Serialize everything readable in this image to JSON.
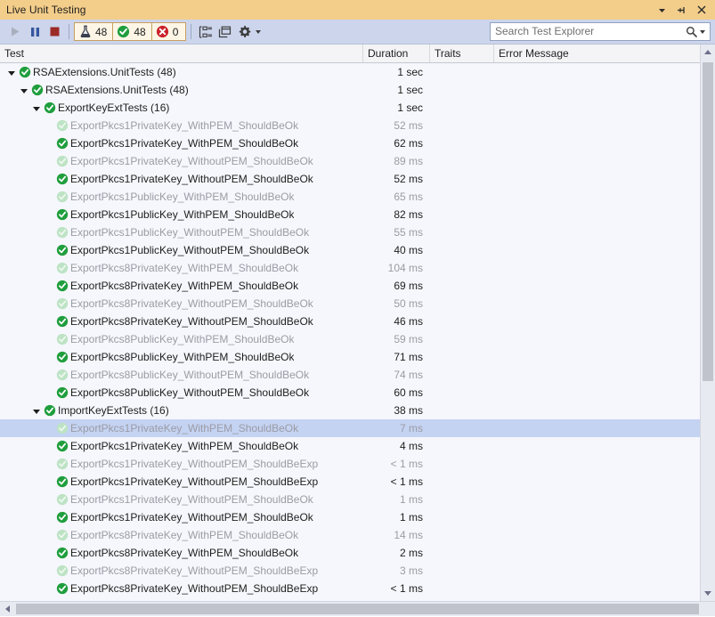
{
  "window": {
    "title": "Live Unit Testing",
    "buttons": [
      {
        "name": "dropdown-menu",
        "label": "▾"
      },
      {
        "name": "pin",
        "label": "pin"
      },
      {
        "name": "close",
        "label": "✕"
      }
    ]
  },
  "toolbar": {
    "run_label": "Start",
    "pause_label": "Pause",
    "stop_label": "Stop",
    "counters": [
      {
        "icon": "flask-icon",
        "value": "48",
        "name": "total-tests-counter"
      },
      {
        "icon": "passed-icon",
        "value": "48",
        "name": "passed-tests-counter"
      },
      {
        "icon": "failed-icon",
        "value": "0",
        "name": "failed-tests-counter"
      }
    ],
    "group_by_label": "Group By",
    "window_layout_label": "Window Layout",
    "settings_label": "Settings"
  },
  "search": {
    "placeholder": "Search Test Explorer",
    "value": ""
  },
  "grid": {
    "columns": [
      {
        "key": "test",
        "label": "Test"
      },
      {
        "key": "duration",
        "label": "Duration"
      },
      {
        "key": "traits",
        "label": "Traits"
      },
      {
        "key": "errmsg",
        "label": "Error Message"
      }
    ]
  },
  "rows": [
    {
      "level": 0,
      "expander": true,
      "state": "passed",
      "label": "RSAExtensions.UnitTests (48)",
      "duration": "1 sec",
      "faded": false,
      "selected": false
    },
    {
      "level": 1,
      "expander": true,
      "state": "passed",
      "label": "RSAExtensions.UnitTests (48)",
      "duration": "1 sec",
      "faded": false,
      "selected": false
    },
    {
      "level": 2,
      "expander": true,
      "state": "passed",
      "label": "ExportKeyExtTests (16)",
      "duration": "1 sec",
      "faded": false,
      "selected": false
    },
    {
      "level": 3,
      "expander": false,
      "state": "passed-faded",
      "label": "ExportPkcs1PrivateKey_WithPEM_ShouldBeOk",
      "duration": "52 ms",
      "faded": true,
      "selected": false
    },
    {
      "level": 3,
      "expander": false,
      "state": "passed",
      "label": "ExportPkcs1PrivateKey_WithPEM_ShouldBeOk",
      "duration": "62 ms",
      "faded": false,
      "selected": false
    },
    {
      "level": 3,
      "expander": false,
      "state": "passed-faded",
      "label": "ExportPkcs1PrivateKey_WithoutPEM_ShouldBeOk",
      "duration": "89 ms",
      "faded": true,
      "selected": false
    },
    {
      "level": 3,
      "expander": false,
      "state": "passed",
      "label": "ExportPkcs1PrivateKey_WithoutPEM_ShouldBeOk",
      "duration": "52 ms",
      "faded": false,
      "selected": false
    },
    {
      "level": 3,
      "expander": false,
      "state": "passed-faded",
      "label": "ExportPkcs1PublicKey_WithPEM_ShouldBeOk",
      "duration": "65 ms",
      "faded": true,
      "selected": false
    },
    {
      "level": 3,
      "expander": false,
      "state": "passed",
      "label": "ExportPkcs1PublicKey_WithPEM_ShouldBeOk",
      "duration": "82 ms",
      "faded": false,
      "selected": false
    },
    {
      "level": 3,
      "expander": false,
      "state": "passed-faded",
      "label": "ExportPkcs1PublicKey_WithoutPEM_ShouldBeOk",
      "duration": "55 ms",
      "faded": true,
      "selected": false
    },
    {
      "level": 3,
      "expander": false,
      "state": "passed",
      "label": "ExportPkcs1PublicKey_WithoutPEM_ShouldBeOk",
      "duration": "40 ms",
      "faded": false,
      "selected": false
    },
    {
      "level": 3,
      "expander": false,
      "state": "passed-faded",
      "label": "ExportPkcs8PrivateKey_WithPEM_ShouldBeOk",
      "duration": "104 ms",
      "faded": true,
      "selected": false
    },
    {
      "level": 3,
      "expander": false,
      "state": "passed",
      "label": "ExportPkcs8PrivateKey_WithPEM_ShouldBeOk",
      "duration": "69 ms",
      "faded": false,
      "selected": false
    },
    {
      "level": 3,
      "expander": false,
      "state": "passed-faded",
      "label": "ExportPkcs8PrivateKey_WithoutPEM_ShouldBeOk",
      "duration": "50 ms",
      "faded": true,
      "selected": false
    },
    {
      "level": 3,
      "expander": false,
      "state": "passed",
      "label": "ExportPkcs8PrivateKey_WithoutPEM_ShouldBeOk",
      "duration": "46 ms",
      "faded": false,
      "selected": false
    },
    {
      "level": 3,
      "expander": false,
      "state": "passed-faded",
      "label": "ExportPkcs8PublicKey_WithPEM_ShouldBeOk",
      "duration": "59 ms",
      "faded": true,
      "selected": false
    },
    {
      "level": 3,
      "expander": false,
      "state": "passed",
      "label": "ExportPkcs8PublicKey_WithPEM_ShouldBeOk",
      "duration": "71 ms",
      "faded": false,
      "selected": false
    },
    {
      "level": 3,
      "expander": false,
      "state": "passed-faded",
      "label": "ExportPkcs8PublicKey_WithoutPEM_ShouldBeOk",
      "duration": "74 ms",
      "faded": true,
      "selected": false
    },
    {
      "level": 3,
      "expander": false,
      "state": "passed",
      "label": "ExportPkcs8PublicKey_WithoutPEM_ShouldBeOk",
      "duration": "60 ms",
      "faded": false,
      "selected": false
    },
    {
      "level": 2,
      "expander": true,
      "state": "passed",
      "label": "ImportKeyExtTests (16)",
      "duration": "38 ms",
      "faded": false,
      "selected": false
    },
    {
      "level": 3,
      "expander": false,
      "state": "passed-faded",
      "label": "ExportPkcs1PrivateKey_WithPEM_ShouldBeOk",
      "duration": "7 ms",
      "faded": true,
      "selected": true
    },
    {
      "level": 3,
      "expander": false,
      "state": "passed",
      "label": "ExportPkcs1PrivateKey_WithPEM_ShouldBeOk",
      "duration": "4 ms",
      "faded": false,
      "selected": false
    },
    {
      "level": 3,
      "expander": false,
      "state": "passed-faded",
      "label": "ExportPkcs1PrivateKey_WithoutPEM_ShouldBeExp",
      "duration": "< 1 ms",
      "faded": true,
      "selected": false
    },
    {
      "level": 3,
      "expander": false,
      "state": "passed",
      "label": "ExportPkcs1PrivateKey_WithoutPEM_ShouldBeExp",
      "duration": "< 1 ms",
      "faded": false,
      "selected": false
    },
    {
      "level": 3,
      "expander": false,
      "state": "passed-faded",
      "label": "ExportPkcs1PrivateKey_WithoutPEM_ShouldBeOk",
      "duration": "1 ms",
      "faded": true,
      "selected": false
    },
    {
      "level": 3,
      "expander": false,
      "state": "passed",
      "label": "ExportPkcs1PrivateKey_WithoutPEM_ShouldBeOk",
      "duration": "1 ms",
      "faded": false,
      "selected": false
    },
    {
      "level": 3,
      "expander": false,
      "state": "passed-faded",
      "label": "ExportPkcs8PrivateKey_WithPEM_ShouldBeOk",
      "duration": "14 ms",
      "faded": true,
      "selected": false
    },
    {
      "level": 3,
      "expander": false,
      "state": "passed",
      "label": "ExportPkcs8PrivateKey_WithPEM_ShouldBeOk",
      "duration": "2 ms",
      "faded": false,
      "selected": false
    },
    {
      "level": 3,
      "expander": false,
      "state": "passed-faded",
      "label": "ExportPkcs8PrivateKey_WithoutPEM_ShouldBeExp",
      "duration": "3 ms",
      "faded": true,
      "selected": false
    },
    {
      "level": 3,
      "expander": false,
      "state": "passed",
      "label": "ExportPkcs8PrivateKey_WithoutPEM_ShouldBeExp",
      "duration": "< 1 ms",
      "faded": false,
      "selected": false
    }
  ],
  "colors": {
    "titlebar": "#f3cd8a",
    "toolbar": "#ccd5ec",
    "pass_green": "#1f9e3d",
    "fail_red": "#cc2229",
    "selection": "#c4d3f2",
    "list_bg": "#f6f7fc"
  }
}
